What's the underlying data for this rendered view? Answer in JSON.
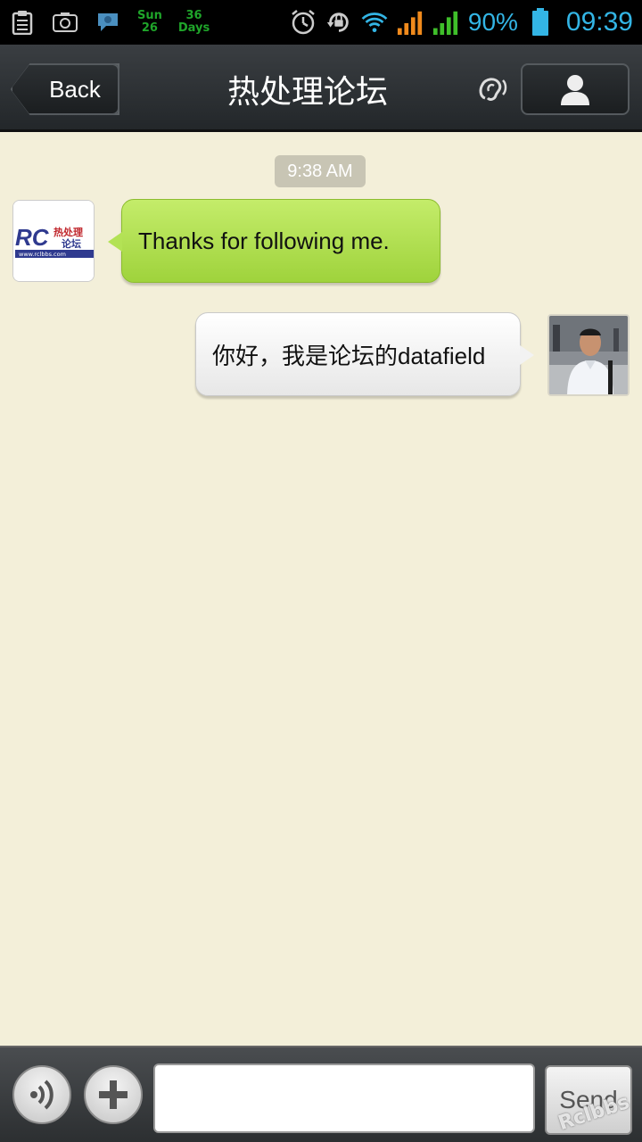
{
  "status_bar": {
    "day": "Sun",
    "date": "26",
    "countdown_num": "36",
    "countdown_unit": "Days",
    "battery_percent": "90%",
    "time": "09:39",
    "icons": [
      "clipboard-icon",
      "camera-icon",
      "chat-notification-icon",
      "alarm-icon",
      "rotation-lock-icon",
      "wifi-icon",
      "signal-icon-orange",
      "signal-icon-green",
      "battery-icon"
    ]
  },
  "header": {
    "back_label": "Back",
    "title": "热处理论坛",
    "ear_icon": "ear-icon",
    "profile_icon": "person-icon"
  },
  "chat": {
    "timestamp": "9:38 AM",
    "messages": [
      {
        "direction": "incoming",
        "text": "Thanks for following me.",
        "avatar_logo": "forum-logo"
      },
      {
        "direction": "outgoing",
        "text": "你好，我是论坛的datafield",
        "avatar": "user-photo"
      }
    ]
  },
  "input_bar": {
    "voice_icon": "voice-icon",
    "add_icon": "plus-icon",
    "message_value": "",
    "send_label": "Send"
  },
  "logo": {
    "text": "RC",
    "cn_line1": "热处理",
    "cn_line2": "论坛",
    "url": "www.rclbbs.com"
  },
  "watermark": "Rclbbs",
  "colors": {
    "incoming_bubble": "#a9dc45",
    "outgoing_bubble": "#f2f2f2",
    "chat_background": "#f3efd9",
    "header_background": "#2b2f32",
    "status_accent": "#33b5e5"
  }
}
